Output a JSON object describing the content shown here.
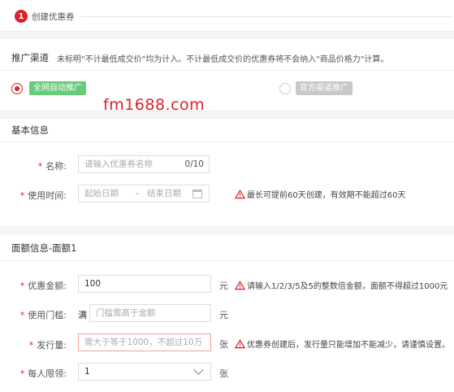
{
  "step": {
    "number": "1",
    "label": "创建优惠券"
  },
  "channel": {
    "title": "推广渠道",
    "note": "未标明\"不计最低成交价\"均为计入。不计最低成交价的优惠券将不会纳入\"商品价格力\"计算。",
    "options": [
      {
        "label": "全网自动推广",
        "selected": true
      },
      {
        "label": "官方渠道推广",
        "selected": false
      }
    ]
  },
  "watermark": "fm1688.com",
  "basic": {
    "title": "基本信息",
    "name_label": "名称:",
    "name_placeholder": "请输入优惠券名称",
    "name_counter": "0/10",
    "time_label": "使用时间:",
    "start_placeholder": "起始日期",
    "date_separator": "-",
    "end_placeholder": "结束日期",
    "time_hint": "最长可提前60天创建，有效期不能超过60天"
  },
  "amount": {
    "title": "面额信息-面额1",
    "value_label": "优惠金额:",
    "value": "100",
    "value_unit": "元",
    "value_hint": "请输入1/2/3/5及5的整数倍金额，面额不得超过1000元",
    "threshold_label": "使用门槛:",
    "threshold_prefix": "满",
    "threshold_placeholder": "门槛需高于金额",
    "threshold_unit": "元",
    "quantity_label": "发行量:",
    "quantity_placeholder": "需大于等于1000，不超过10万",
    "quantity_unit": "张",
    "quantity_hint": "优惠券创建后，发行量只能增加不能减少，请谨慎设置。",
    "limit_label": "每人限领:",
    "limit_value": "1",
    "limit_unit": "张"
  },
  "colors": {
    "accent": "#e0202a",
    "success": "#66cc7a",
    "disabled": "#c8c8c8",
    "warning": "#e0202a"
  }
}
